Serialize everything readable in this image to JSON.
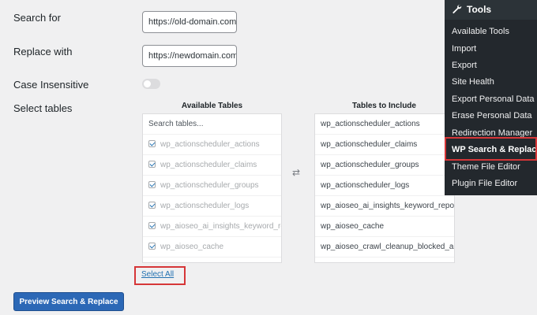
{
  "form": {
    "search_label": "Search for",
    "search_value": "https://old-domain.com",
    "replace_label": "Replace with",
    "replace_value": "https://newdomain.com",
    "case_label": "Case Insensitive",
    "case_insensitive_on": false,
    "tables_label": "Select tables"
  },
  "available": {
    "title": "Available Tables",
    "search_placeholder": "Search tables...",
    "items": [
      {
        "label": "wp_actionscheduler_actions",
        "checked": true
      },
      {
        "label": "wp_actionscheduler_claims",
        "checked": true
      },
      {
        "label": "wp_actionscheduler_groups",
        "checked": true
      },
      {
        "label": "wp_actionscheduler_logs",
        "checked": true
      },
      {
        "label": "wp_aioseo_ai_insights_keyword_rep",
        "checked": true
      },
      {
        "label": "wp_aioseo_cache",
        "checked": true
      }
    ],
    "select_all": "Select All"
  },
  "included": {
    "title": "Tables to Include",
    "items": [
      "wp_actionscheduler_actions",
      "wp_actionscheduler_claims",
      "wp_actionscheduler_groups",
      "wp_actionscheduler_logs",
      "wp_aioseo_ai_insights_keyword_reports",
      "wp_aioseo_cache",
      "wp_aioseo_crawl_cleanup_blocked_args"
    ]
  },
  "swap_icon": "⇄",
  "actions": {
    "preview_label": "Preview Search & Replace"
  },
  "menu": {
    "title": "Tools",
    "icon": "wrench-icon",
    "items": [
      "Available Tools",
      "Import",
      "Export",
      "Site Health",
      "Export Personal Data",
      "Erase Personal Data",
      "Redirection Manager",
      "WP Search & Replace",
      "Theme File Editor",
      "Plugin File Editor"
    ],
    "current_index": 7
  },
  "colors": {
    "accent": "#2271b1",
    "button": "#2c68b6",
    "highlight": "#d63638",
    "menu_bg": "#23282d"
  }
}
